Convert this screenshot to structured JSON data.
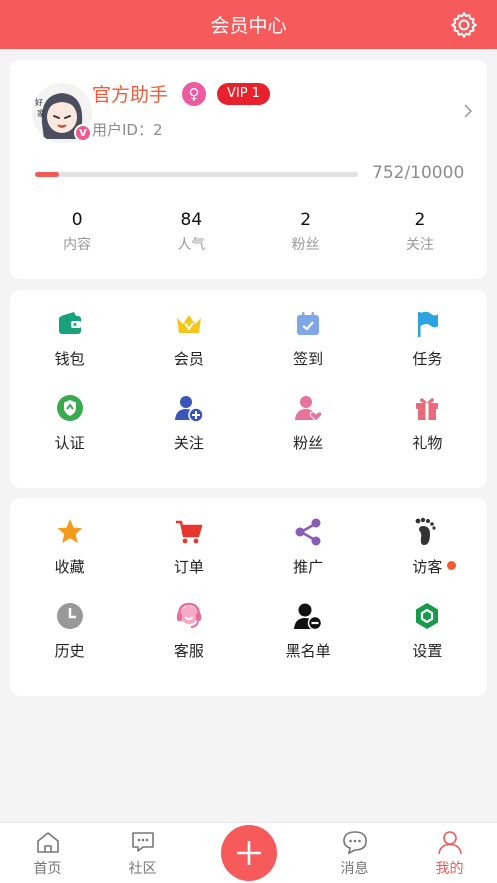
{
  "header": {
    "title": "会员中心"
  },
  "profile": {
    "username": "官方助手",
    "vip_label": "VIP 1",
    "user_id_text": "用户ID：2",
    "avatar_badge": "V",
    "progress_text": "752/10000",
    "progress_fraction": 0.075,
    "stats": [
      {
        "value": "0",
        "label": "内容"
      },
      {
        "value": "84",
        "label": "人气"
      },
      {
        "value": "2",
        "label": "粉丝"
      },
      {
        "value": "2",
        "label": "关注"
      }
    ]
  },
  "menu1": [
    {
      "label": "钱包",
      "icon": "wallet-icon",
      "color": "#17a37c"
    },
    {
      "label": "会员",
      "icon": "crown-icon",
      "color": "#f5c518"
    },
    {
      "label": "签到",
      "icon": "calendar-icon",
      "color": "#7fa6e6"
    },
    {
      "label": "任务",
      "icon": "flag-icon",
      "color": "#2aa3e0"
    },
    {
      "label": "认证",
      "icon": "shield-icon",
      "color": "#3aaa4e"
    },
    {
      "label": "关注",
      "icon": "add-user-icon",
      "color": "#3a56b8"
    },
    {
      "label": "粉丝",
      "icon": "fans-icon",
      "color": "#e8729a"
    },
    {
      "label": "礼物",
      "icon": "gift-icon",
      "color": "#e86b7c"
    }
  ],
  "menu2": [
    {
      "label": "收藏",
      "icon": "star-icon",
      "color": "#f59a1a"
    },
    {
      "label": "订单",
      "icon": "cart-icon",
      "color": "#e8362e"
    },
    {
      "label": "推广",
      "icon": "share-icon",
      "color": "#8b5bb8"
    },
    {
      "label": "访客",
      "icon": "footprint-icon",
      "color": "#333333"
    },
    {
      "label": "历史",
      "icon": "clock-icon",
      "color": "#999999"
    },
    {
      "label": "客服",
      "icon": "headset-icon",
      "color": "#ef6b9a"
    },
    {
      "label": "黑名单",
      "icon": "block-user-icon",
      "color": "#111111"
    },
    {
      "label": "设置",
      "icon": "settings-hex-icon",
      "color": "#179a4c"
    }
  ],
  "nav": [
    {
      "label": "首页",
      "icon": "home-icon"
    },
    {
      "label": "社区",
      "icon": "community-icon"
    },
    {
      "label": "消息",
      "icon": "message-icon"
    },
    {
      "label": "我的",
      "icon": "profile-icon"
    }
  ],
  "colors": {
    "brand": "#f75a5a",
    "accent_text": "#f25c3a",
    "vip": "#e8212e"
  }
}
